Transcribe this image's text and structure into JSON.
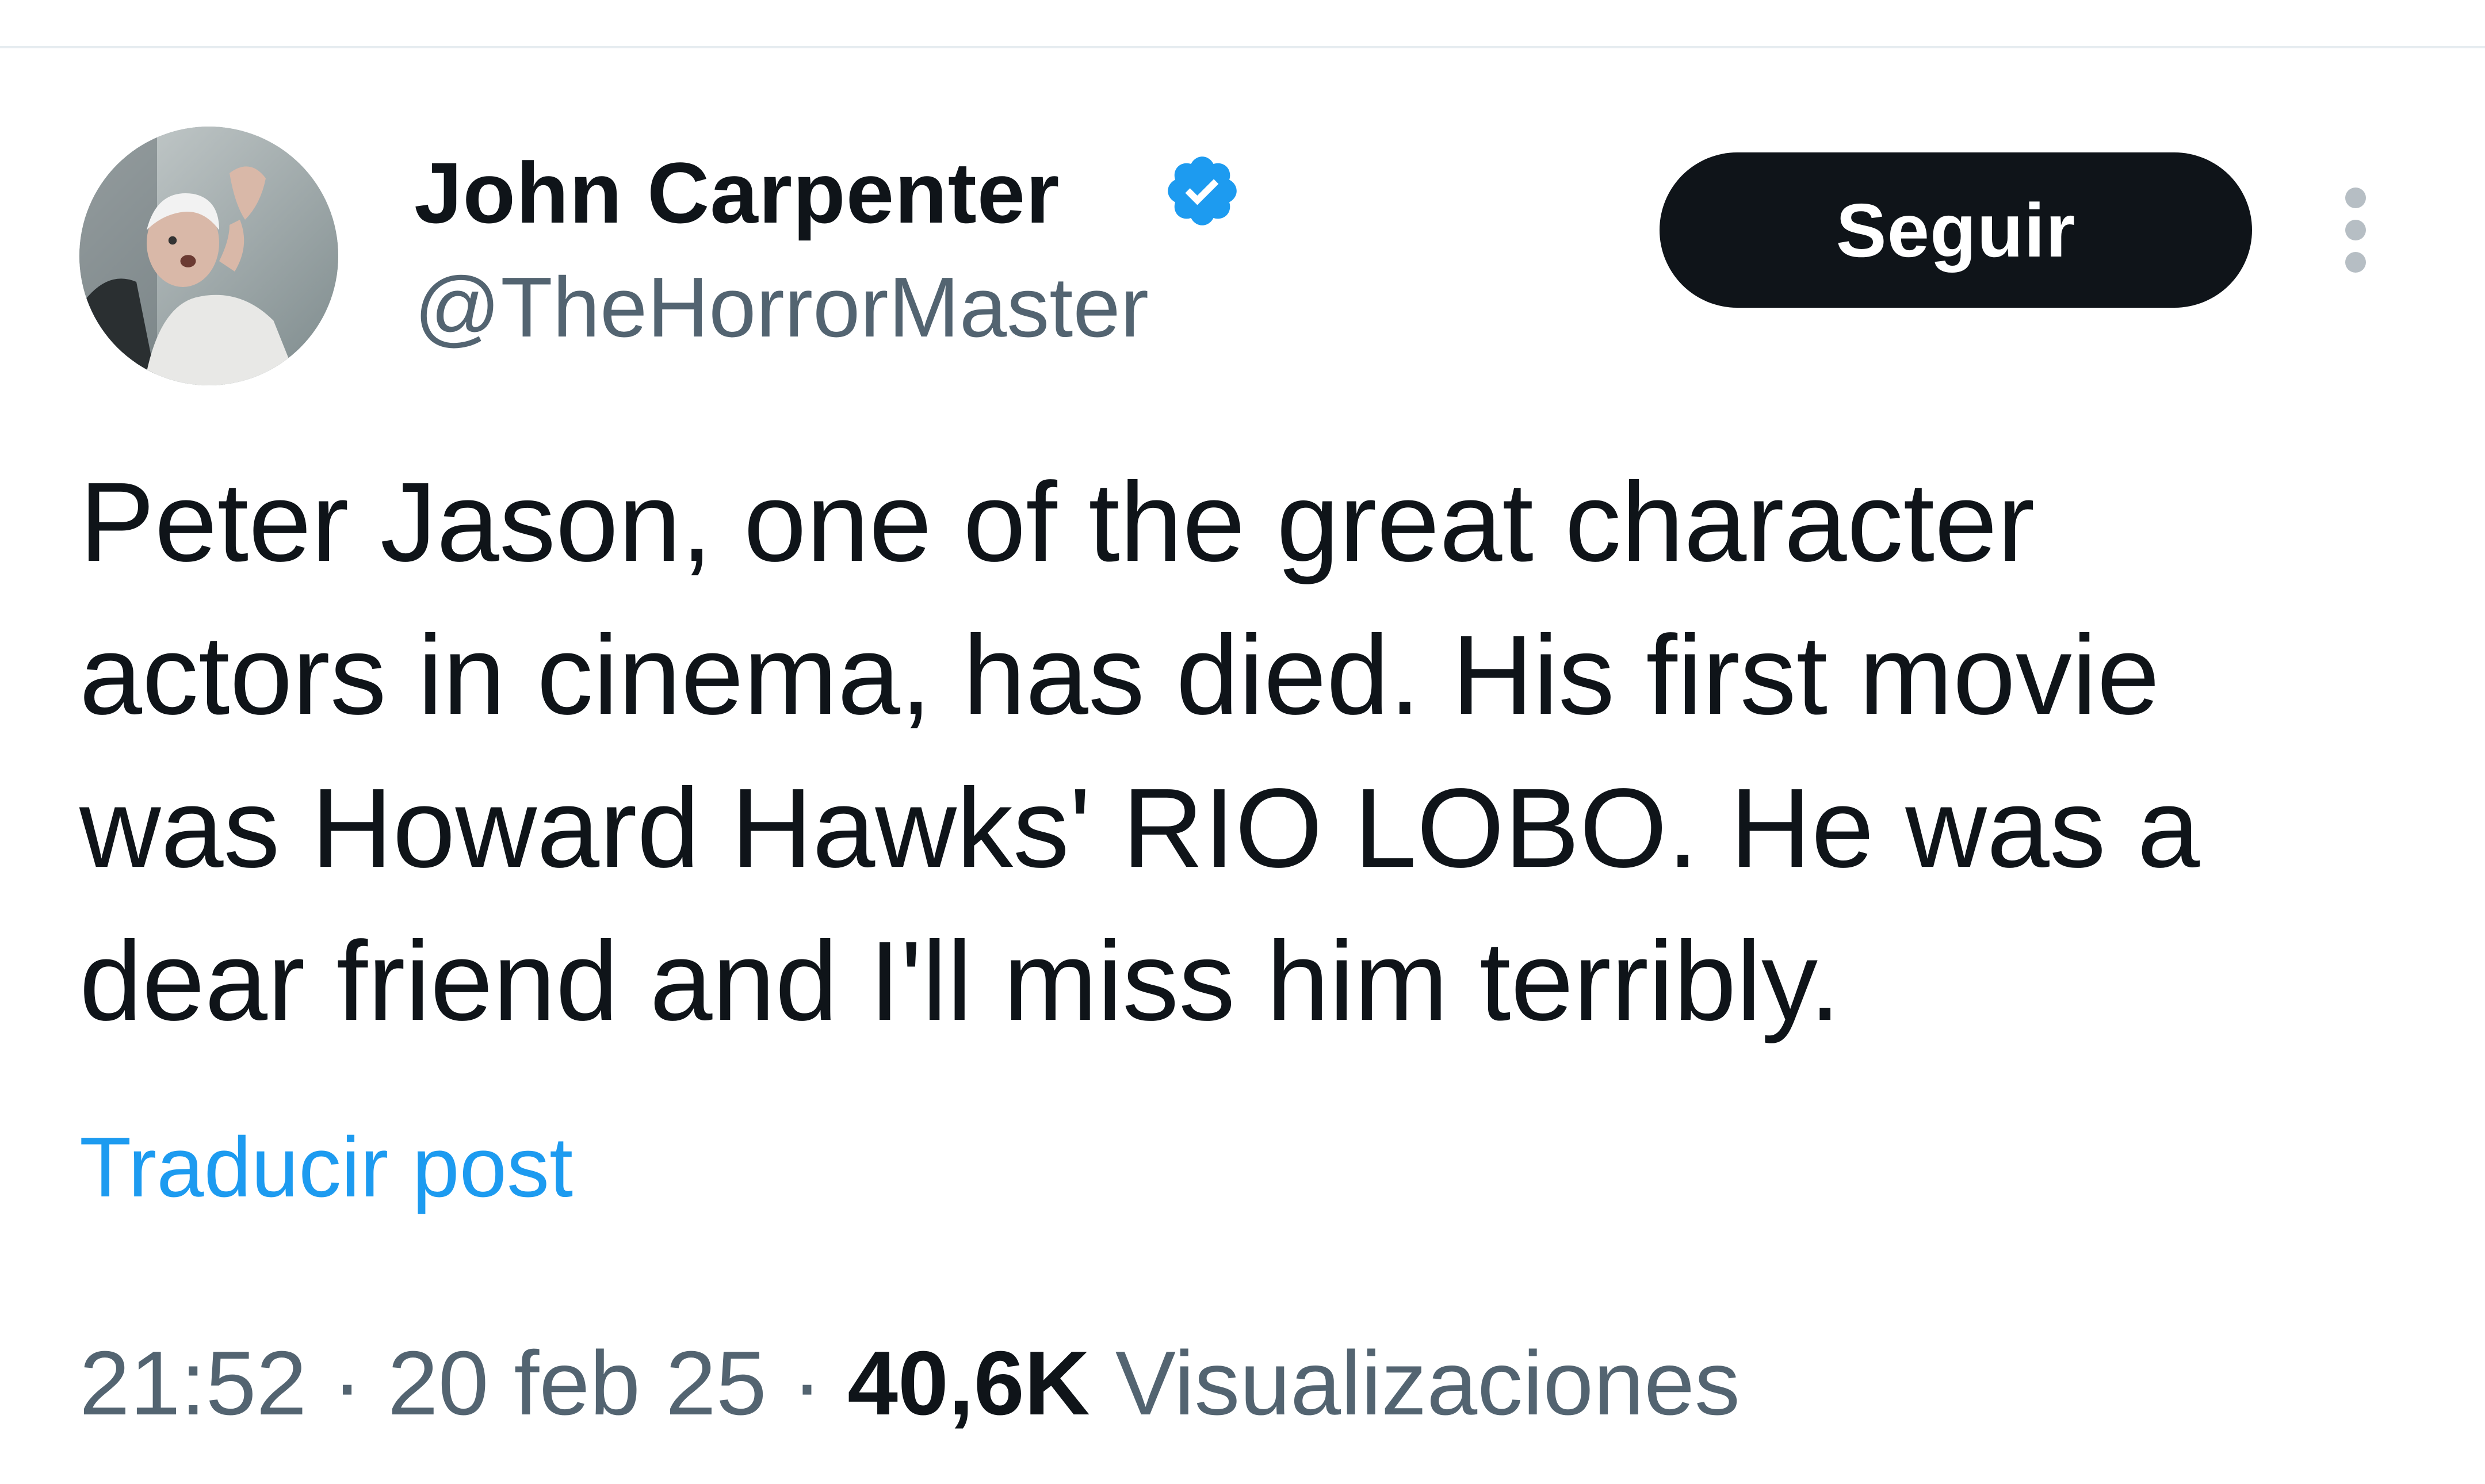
{
  "author": {
    "name": "John Carpenter",
    "handle": "@TheHorrorMaster",
    "verified_icon": "verified-badge-icon",
    "verified_color": "#1d9bf0"
  },
  "actions": {
    "follow_label": "Seguir",
    "more_icon": "more-vertical-icon"
  },
  "tweet": {
    "lines": [
      "Peter Jason, one of the great character",
      "actors in cinema, has died. His first movie",
      "was Howard Hawks' RIO LOBO. He was a",
      "dear friend and I'll miss him terribly."
    ],
    "translate_label": "Traducir post"
  },
  "meta": {
    "time": "21:52",
    "separator": "·",
    "date": "20 feb 25",
    "views_count": "40,6K",
    "views_label": "Visualizaciones"
  },
  "colors": {
    "text": "#0f1419",
    "secondary": "#536471",
    "link": "#1d9bf0",
    "button_bg": "#0f1419"
  }
}
